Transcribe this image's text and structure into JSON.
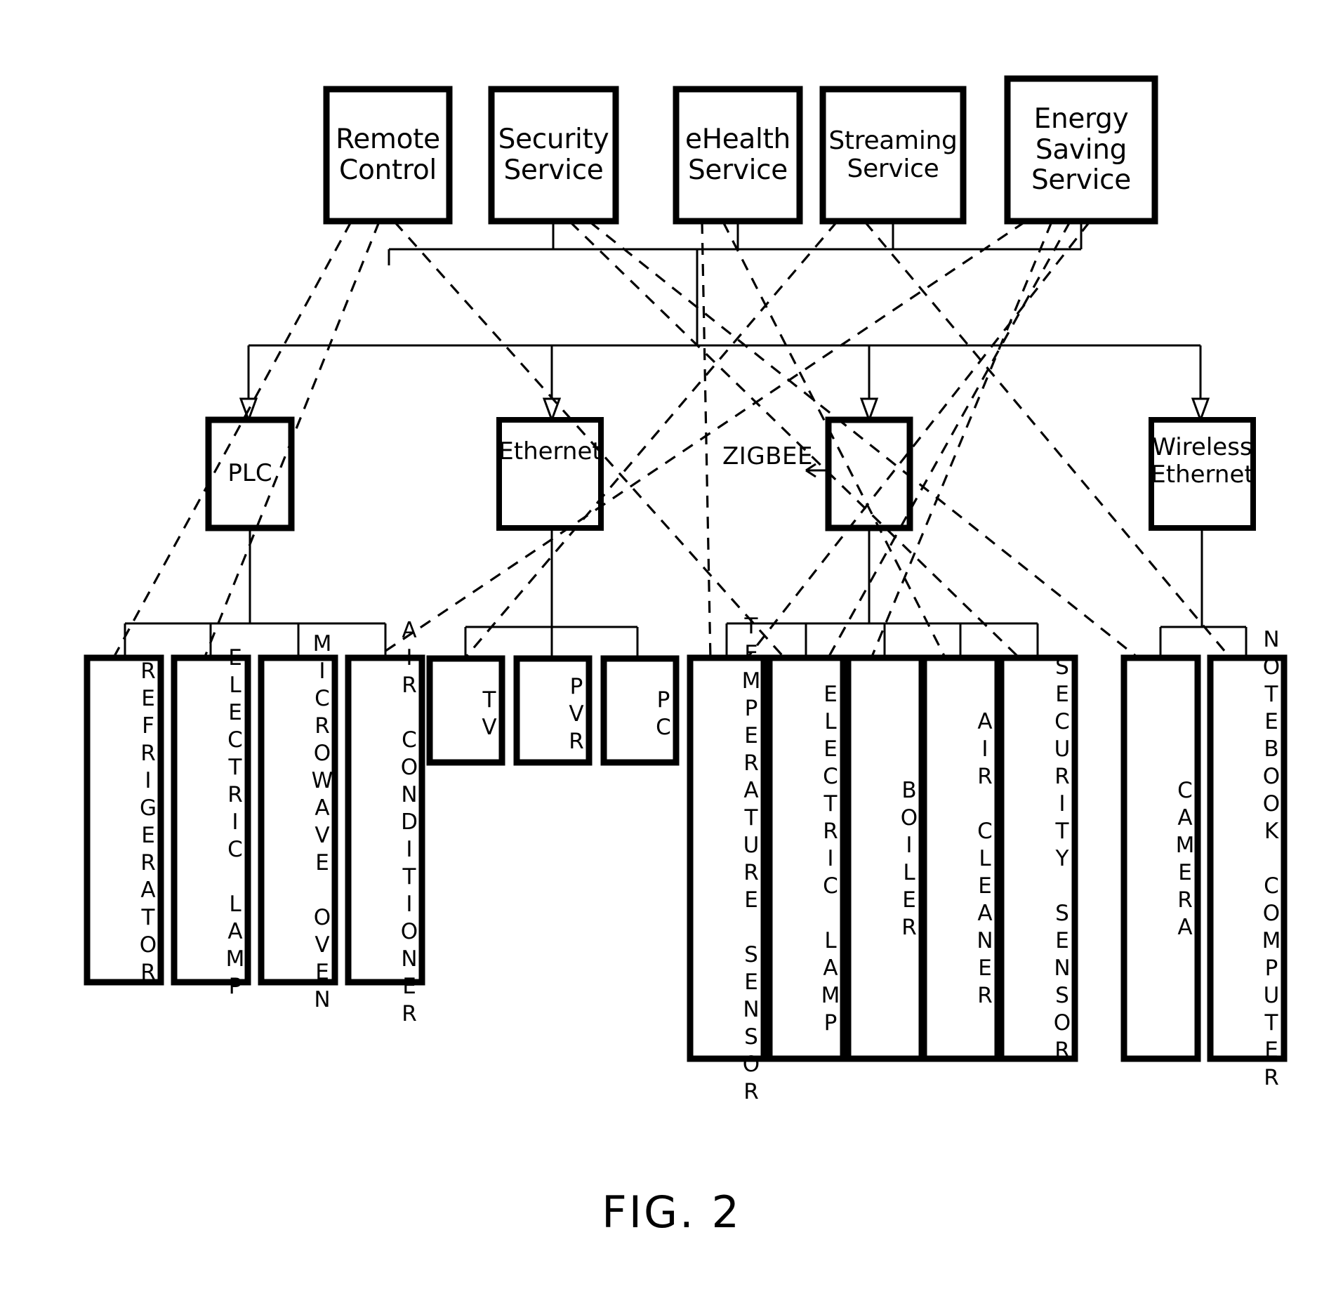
{
  "figure": {
    "caption": "FIG. 2",
    "callout_label": "ZIGBEE"
  },
  "services": [
    {
      "id": "remote-control",
      "lines": [
        "Remote",
        "Control"
      ]
    },
    {
      "id": "security-service",
      "lines": [
        "Security",
        "Service"
      ]
    },
    {
      "id": "ehealth-service",
      "lines": [
        "eHealth",
        "Service"
      ]
    },
    {
      "id": "streaming-service",
      "lines": [
        "Streaming",
        "Service"
      ]
    },
    {
      "id": "energy-saving-service",
      "lines": [
        "Energy",
        "Saving",
        "Service"
      ]
    }
  ],
  "networks": [
    {
      "id": "plc",
      "lines": [
        "PLC"
      ]
    },
    {
      "id": "ethernet",
      "lines": [
        "Ethernet"
      ]
    },
    {
      "id": "zigbee",
      "lines": []
    },
    {
      "id": "wireless-ethernet",
      "lines": [
        "Wireless",
        "Ethernet"
      ]
    }
  ],
  "devices": {
    "plc_group": [
      {
        "id": "refrigerator",
        "label": "REFRIGERATOR"
      },
      {
        "id": "electric-lamp-plc",
        "label": "ELECTRIC LAMP"
      },
      {
        "id": "microwave-oven",
        "label": "MICROWAVE OVEN"
      },
      {
        "id": "air-conditioner",
        "label": "AIR CONDITIONER"
      }
    ],
    "ethernet_group": [
      {
        "id": "tv",
        "label": "TV"
      },
      {
        "id": "pvr",
        "label": "PVR"
      },
      {
        "id": "pc",
        "label": "PC"
      }
    ],
    "zigbee_group": [
      {
        "id": "temperature-sensor",
        "label": "TEMPERATURE SENSOR"
      },
      {
        "id": "electric-lamp-zigbee",
        "label": "ELECTRIC LAMP"
      },
      {
        "id": "boiler",
        "label": "BOILER"
      },
      {
        "id": "air-cleaner",
        "label": "AIR CLEANER"
      },
      {
        "id": "security-sensor",
        "label": "SECURITY SENSOR"
      }
    ],
    "wireless_group": [
      {
        "id": "camera",
        "label": "CAMERA"
      },
      {
        "id": "notebook-computer",
        "label": "NOTEBOOK COMPUTER"
      }
    ]
  },
  "colors": {
    "line": "#000000",
    "background": "#ffffff"
  }
}
